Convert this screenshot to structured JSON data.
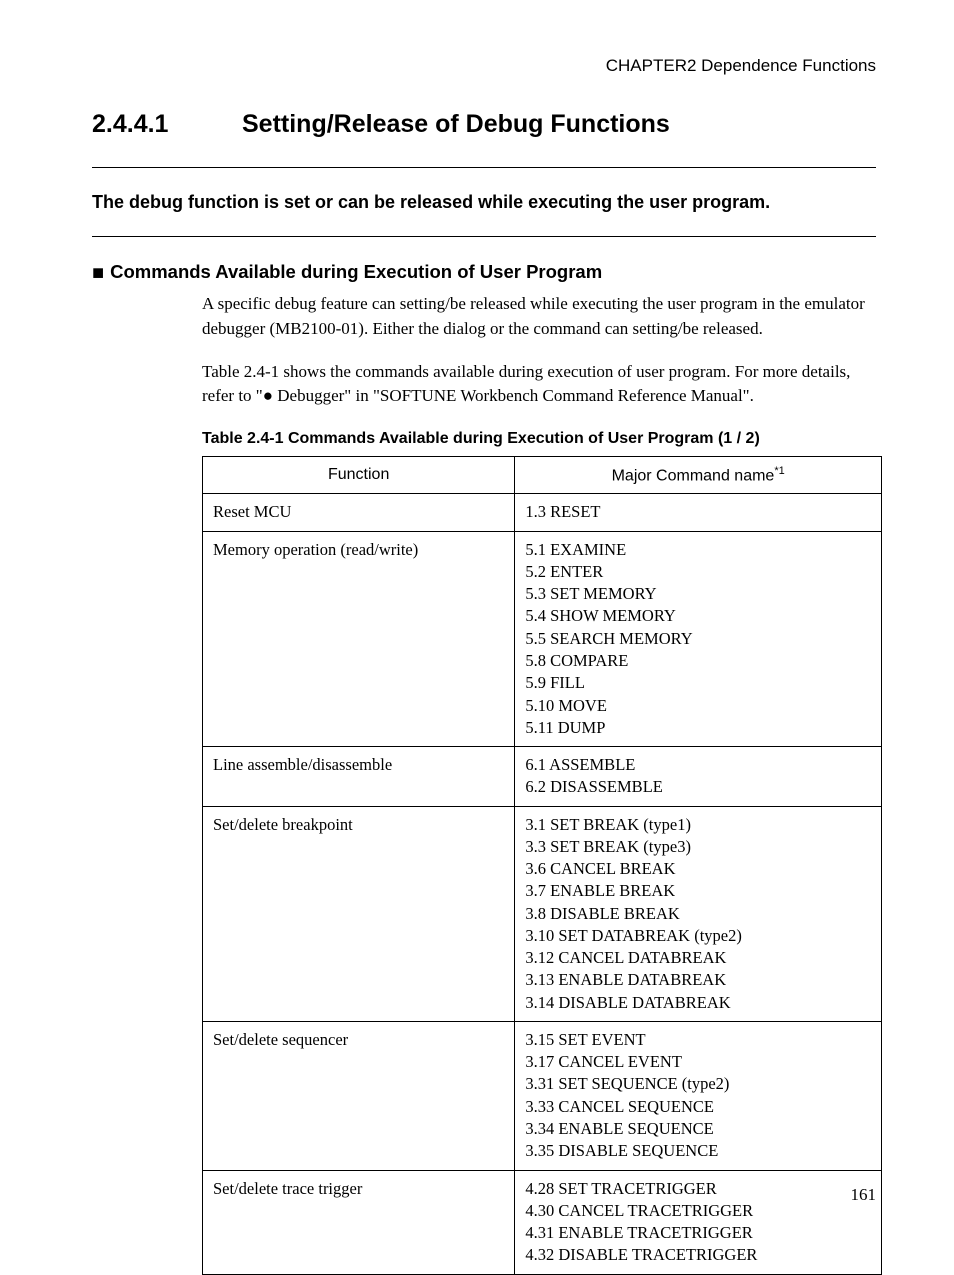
{
  "header": {
    "chapter": "CHAPTER2  Dependence Functions"
  },
  "section": {
    "number": "2.4.4.1",
    "title": "Setting/Release of Debug Functions"
  },
  "summary": "The debug function is set or can be released while executing the user program.",
  "subheading": {
    "bullet": "■",
    "text": "Commands Available during Execution of User Program"
  },
  "body": {
    "p1": "A specific debug feature can setting/be released while executing the user program in the emulator debugger (MB2100-01). Either the dialog or the command can setting/be released.",
    "p2": "Table 2.4-1 shows the commands available during execution of user program. For more details, refer to \"● Debugger\" in \"SOFTUNE Workbench Command Reference Manual\"."
  },
  "table": {
    "caption": "Table 2.4-1  Commands Available during Execution of User Program (1 / 2)",
    "headers": {
      "col1": "Function",
      "col2": "Major Command name",
      "col2_sup": "*1"
    },
    "rows": [
      {
        "fn": "Reset MCU",
        "cmds": [
          "1.3 RESET"
        ]
      },
      {
        "fn": "Memory operation (read/write)",
        "cmds": [
          "5.1 EXAMINE",
          "5.2 ENTER",
          "5.3 SET MEMORY",
          "5.4 SHOW MEMORY",
          "5.5 SEARCH MEMORY",
          "5.8 COMPARE",
          "5.9 FILL",
          "5.10 MOVE",
          "5.11 DUMP"
        ]
      },
      {
        "fn": "Line assemble/disassemble",
        "cmds": [
          "6.1 ASSEMBLE",
          "6.2 DISASSEMBLE"
        ]
      },
      {
        "fn": "Set/delete breakpoint",
        "cmds": [
          "3.1 SET BREAK (type1)",
          "3.3 SET BREAK (type3)",
          "3.6 CANCEL BREAK",
          "3.7 ENABLE BREAK",
          "3.8 DISABLE BREAK",
          "3.10 SET DATABREAK (type2)",
          "3.12 CANCEL DATABREAK",
          "3.13 ENABLE DATABREAK",
          "3.14 DISABLE DATABREAK"
        ]
      },
      {
        "fn": "Set/delete sequencer",
        "cmds": [
          "3.15 SET EVENT",
          "3.17 CANCEL EVENT",
          "3.31 SET SEQUENCE (type2)",
          "3.33 CANCEL SEQUENCE",
          "3.34 ENABLE SEQUENCE",
          "3.35 DISABLE SEQUENCE"
        ]
      },
      {
        "fn": "Set/delete trace trigger",
        "cmds": [
          "4.28 SET TRACETRIGGER",
          "4.30 CANCEL TRACETRIGGER",
          "4.31 ENABLE TRACETRIGGER",
          "4.32 DISABLE TRACETRIGGER"
        ]
      }
    ]
  },
  "page_number": "161"
}
